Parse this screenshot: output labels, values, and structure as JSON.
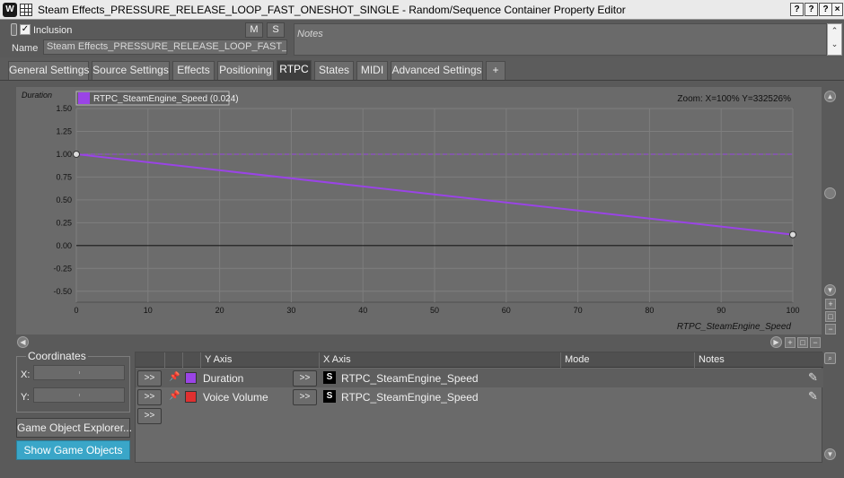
{
  "window": {
    "title": "Steam Effects_PRESSURE_RELEASE_LOOP_FAST_ONESHOT_SINGLE - Random/Sequence Container Property Editor",
    "app_icon": "wwise-logo-icon",
    "buttons": [
      "?|?",
      "?|?",
      "?",
      "×"
    ]
  },
  "header": {
    "inclusion_label": "Inclusion",
    "inclusion_checked": true,
    "mute_label": "M",
    "solo_label": "S",
    "name_label": "Name",
    "name_value": "Steam Effects_PRESSURE_RELEASE_LOOP_FAST_C",
    "notes_placeholder": "Notes"
  },
  "tabs": [
    {
      "label": "General Settings",
      "active": false
    },
    {
      "label": "Source Settings",
      "active": false
    },
    {
      "label": "Effects",
      "active": false
    },
    {
      "label": "Positioning",
      "active": false
    },
    {
      "label": "RTPC",
      "active": true
    },
    {
      "label": "States",
      "active": false
    },
    {
      "label": "MIDI",
      "active": false
    },
    {
      "label": "Advanced Settings",
      "active": false
    },
    {
      "label": "+",
      "active": false
    }
  ],
  "graph": {
    "y_param_label": "Duration",
    "legend_label": "RTPC_SteamEngine_Speed (0.024)",
    "legend_color": "#9a44e6",
    "zoom_text": "Zoom: X=100% Y=332526%",
    "x_axis_label": "RTPC_SteamEngine_Speed"
  },
  "chart_data": {
    "type": "line",
    "x_ticks": [
      0,
      10,
      20,
      30,
      40,
      50,
      60,
      70,
      80,
      90,
      100
    ],
    "y_ticks": [
      "1.50",
      "1.25",
      "1.00",
      "0.75",
      "0.50",
      "0.25",
      "0.00",
      "-0.25",
      "-0.50"
    ],
    "xlim": [
      0,
      100
    ],
    "ylim": [
      -0.62,
      1.5
    ],
    "series": [
      {
        "name": "RTPC_SteamEngine_Speed",
        "color": "#9a44e6",
        "x": [
          0,
          100
        ],
        "y": [
          1.0,
          0.12
        ]
      }
    ],
    "reference_line": {
      "y": 1.0,
      "style": "dashed",
      "color": "#9a44e6"
    },
    "grid": true
  },
  "coordinates": {
    "title": "Coordinates",
    "x_label": "X:",
    "y_label": "Y:",
    "x_value": "-",
    "y_value": "-"
  },
  "buttons": {
    "explorer": "Game Object Explorer...",
    "show_objects": "Show Game Objects"
  },
  "table": {
    "columns": [
      "Y Axis",
      "X Axis",
      "Mode",
      "Notes"
    ],
    "rows": [
      {
        "go": ">>",
        "y_axis": "Duration",
        "color": "#9a44e6",
        "x_go": ">>",
        "x_axis": "RTPC_SteamEngine_Speed",
        "mode": "",
        "notes": ""
      },
      {
        "go": ">>",
        "y_axis": "Voice Volume",
        "color": "#e03030",
        "x_go": ">>",
        "x_axis": "RTPC_SteamEngine_Speed",
        "mode": "",
        "notes": ""
      }
    ],
    "empty_row_go": ">>"
  }
}
